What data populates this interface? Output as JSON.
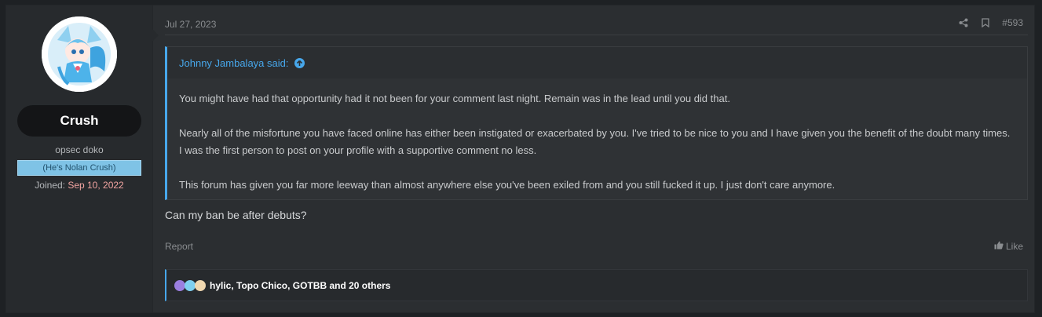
{
  "user": {
    "name": "Crush",
    "title": "opsec doko",
    "banner": "(He's Nolan Crush)",
    "joined_label": "Joined:",
    "joined_date": "Sep 10, 2022"
  },
  "post": {
    "date": "Jul 27, 2023",
    "number": "#593",
    "quote": {
      "author": "Johnny Jambalaya said:",
      "paragraphs": [
        "You might have had that opportunity had it not been for your comment last night. Remain was in the lead until you did that.",
        "Nearly all of the misfortune you have faced online has either been instigated or exacerbated by you. I've tried to be nice to you and I have given you the benefit of the doubt many times. I was the first person to post on your profile with a supportive comment no less.",
        "This forum has given you far more leeway than almost anywhere else you've been exiled from and you still fucked it up. I just don't care anymore."
      ]
    },
    "reply": "Can my ban be after debuts?",
    "report_label": "Report",
    "like_label": "Like",
    "reactions_text": "hylic, Topo Chico, GOTBB and 20 others"
  },
  "icons": {
    "share": "share-icon",
    "bookmark": "bookmark-icon",
    "quote_jump": "arrow-up-circle-icon",
    "like": "thumbs-up-icon"
  },
  "colors": {
    "accent": "#47a7eb",
    "banner_bg": "#7fc3e6",
    "joined_date": "#f3a5a2"
  }
}
